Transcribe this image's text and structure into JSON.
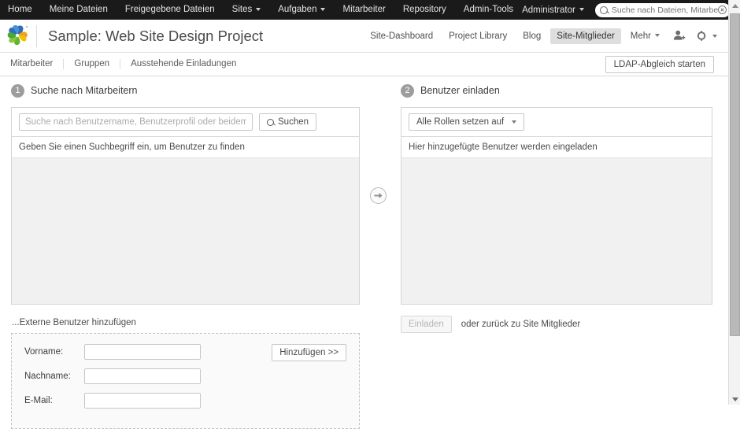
{
  "topnav": {
    "items": [
      {
        "label": "Home",
        "caret": false
      },
      {
        "label": "Meine Dateien",
        "caret": false
      },
      {
        "label": "Freigegebene Dateien",
        "caret": false
      },
      {
        "label": "Sites",
        "caret": true
      },
      {
        "label": "Aufgaben",
        "caret": true
      },
      {
        "label": "Mitarbeiter",
        "caret": false
      },
      {
        "label": "Repository",
        "caret": false
      },
      {
        "label": "Admin-Tools",
        "caret": false
      }
    ],
    "user_label": "Administrator",
    "search_placeholder": "Suche nach Dateien, Mitarbeit",
    "search_value": "",
    "search_icon": "search-icon",
    "clear_icon": "clear-icon"
  },
  "banner": {
    "logo_icon": "alfresco-logo-icon",
    "site_title": "Sample: Web Site Design Project",
    "nav": [
      {
        "label": "Site-Dashboard",
        "active": false,
        "caret": false
      },
      {
        "label": "Project Library",
        "active": false,
        "caret": false
      },
      {
        "label": "Blog",
        "active": false,
        "caret": false
      },
      {
        "label": "Site-Mitglieder",
        "active": true,
        "caret": false
      },
      {
        "label": "Mehr",
        "active": false,
        "caret": true
      }
    ],
    "add_user_icon": "add-user-icon",
    "settings_icon": "gear-icon"
  },
  "subtabs": {
    "items": [
      "Mitarbeiter",
      "Gruppen",
      "Ausstehende Einladungen"
    ],
    "ldap_button": "LDAP-Abgleich starten",
    "annotation_arrow": "red-arrow-annotation",
    "annotation_color": "#e02020"
  },
  "step1": {
    "number": "1",
    "title": "Suche nach Mitarbeitern",
    "search_placeholder": "Suche nach Benutzername, Benutzerprofil oder beidem",
    "search_value": "",
    "search_button": "Suchen",
    "search_button_icon": "search-icon",
    "empty_message": "Geben Sie einen Suchbegriff ein, um Benutzer zu finden"
  },
  "transfer": {
    "icon": "arrow-right-circle-icon"
  },
  "step2": {
    "number": "2",
    "title": "Benutzer einladen",
    "roles_button": "Alle Rollen setzen auf",
    "roles_caret": "caret-down-icon",
    "empty_message": "Hier hinzugefügte Benutzer werden eingeladen",
    "invite_button": "Einladen",
    "invite_button_disabled": true,
    "back_text": "oder zurück zu Site Mitglieder"
  },
  "external": {
    "title": "...Externe Benutzer hinzufügen",
    "fields": [
      {
        "label": "Vorname:",
        "value": "",
        "name": "firstname"
      },
      {
        "label": "Nachname:",
        "value": "",
        "name": "lastname"
      },
      {
        "label": "E-Mail:",
        "value": "",
        "name": "email"
      }
    ],
    "add_button": "Hinzufügen >>"
  },
  "scrollbar": {
    "up_icon": "scroll-up-icon",
    "down_icon": "scroll-down-icon",
    "thumb": "scroll-thumb"
  },
  "colors": {
    "topnav_bg": "#1a1a1a",
    "panel_bg": "#f1f1f1",
    "accent_active": "#dedede",
    "annotation": "#e02020"
  }
}
